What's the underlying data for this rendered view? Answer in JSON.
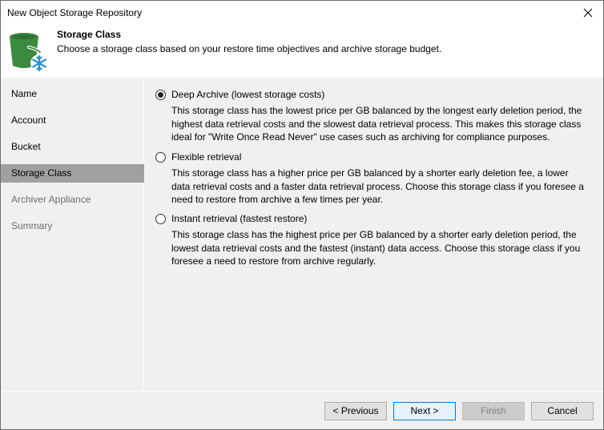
{
  "window": {
    "title": "New Object Storage Repository",
    "close_icon": "close-icon"
  },
  "header": {
    "icon": "bucket-snowflake-icon",
    "title": "Storage Class",
    "subtitle": "Choose a storage class based on your restore time objectives and archive storage budget."
  },
  "sidebar": {
    "items": [
      {
        "label": "Name",
        "state": "normal"
      },
      {
        "label": "Account",
        "state": "normal"
      },
      {
        "label": "Bucket",
        "state": "normal"
      },
      {
        "label": "Storage Class",
        "state": "active"
      },
      {
        "label": "Archiver Appliance",
        "state": "disabled"
      },
      {
        "label": "Summary",
        "state": "disabled"
      }
    ]
  },
  "options": [
    {
      "label": "Deep Archive (lowest storage costs)",
      "checked": true,
      "description": "This storage class has the lowest price per GB balanced by the longest early deletion period, the highest data retrieval costs and the slowest data retrieval process. This makes this storage class ideal for \"Write Once Read Never\" use cases such as archiving for compliance purposes."
    },
    {
      "label": "Flexible retrieval",
      "checked": false,
      "description": "This storage class has a higher price per GB balanced by a shorter early deletion fee, a lower data retrieval costs and a faster data retrieval process. Choose this storage class if you foresee a need to restore from archive a few times per year."
    },
    {
      "label": "Instant retrieval (fastest restore)",
      "checked": false,
      "description": "This storage class has the highest price per GB balanced by a shorter early deletion period, the lowest data retrieval costs and the fastest (instant) data access. Choose this storage class if you foresee a need to restore from archive regularly."
    }
  ],
  "buttons": {
    "previous": "< Previous",
    "next": "Next >",
    "finish": "Finish",
    "cancel": "Cancel"
  },
  "colors": {
    "icon_green": "#3b8a3f",
    "snowflake_blue": "#2b8fd6",
    "active_item": "#a0a0a0",
    "default_button_border": "#0078d7"
  }
}
